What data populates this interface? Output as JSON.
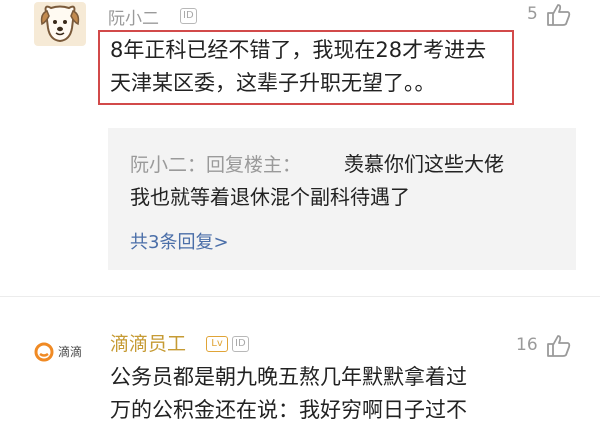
{
  "comments": [
    {
      "user": "阮小二",
      "id_badge": "ID",
      "likes": "5",
      "text": "8年正科已经不错了，我现在28才考进去\n天津某区委，这辈子升职无望了。。",
      "reply": {
        "prefix": "阮小二：回复楼主：",
        "text_line1": "羡慕你们这些大佬",
        "text_line2": "我也就等着退休混个副科待遇了",
        "more": "共3条回复>"
      }
    },
    {
      "user": "滴滴员工",
      "level_badge": "Lv",
      "id_badge": "ID",
      "likes": "16",
      "logo_text": "滴滴",
      "text": "公务员都是朝九晚五熬几年默默拿着过\n万的公积金还在说：我好穷啊日子过不"
    }
  ],
  "colors": {
    "highlight_border": "#d24a4a",
    "reply_link": "#4a6ea8",
    "username_gold": "#c69b34",
    "didi_orange": "#f08a24"
  },
  "icons": [
    "dog-avatar-icon",
    "thumbs-up-icon",
    "didi-logo-icon"
  ]
}
